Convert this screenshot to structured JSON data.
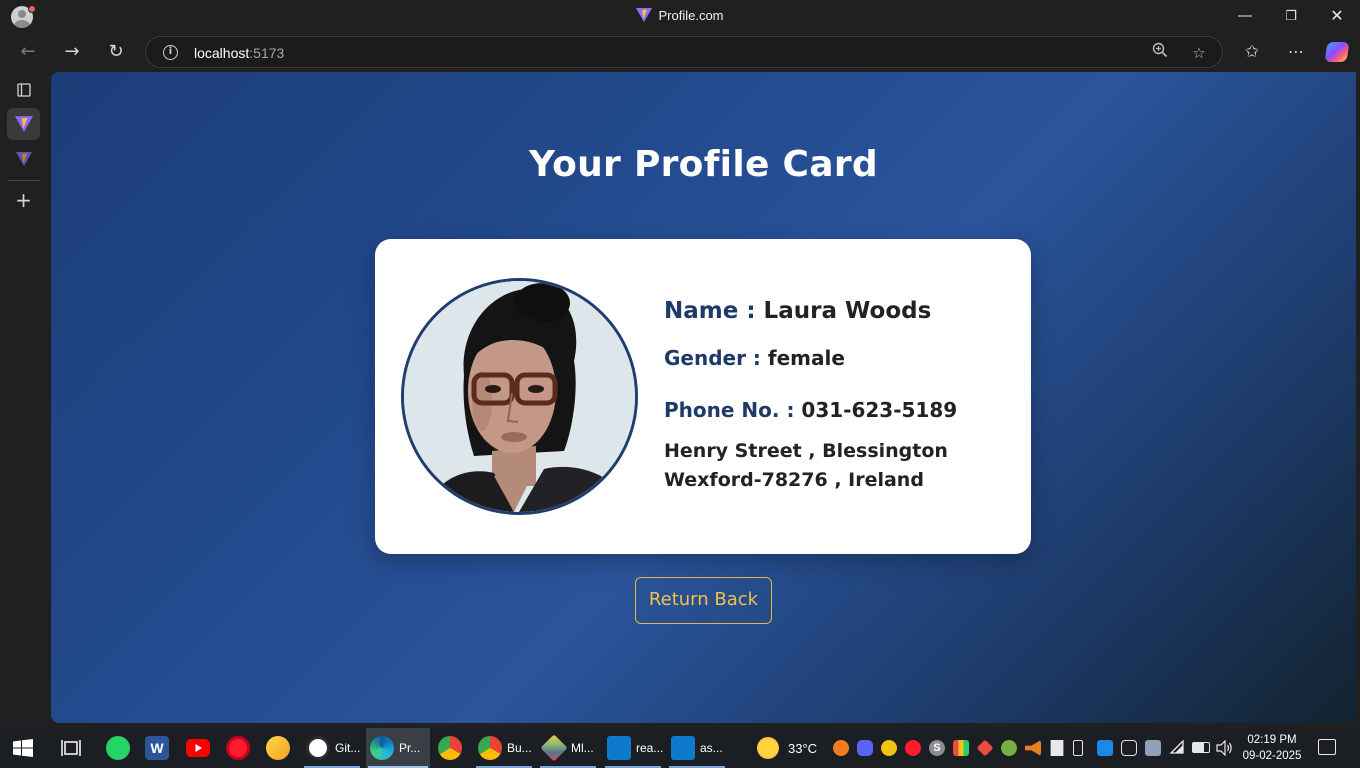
{
  "window": {
    "title": "Profile.com"
  },
  "browser": {
    "url_host": "localhost",
    "url_port": ":5173"
  },
  "page": {
    "title": "Your Profile Card",
    "profile": {
      "name_label": "Name : ",
      "name_value": " Laura  Woods",
      "gender_label": "Gender : ",
      "gender_value": "female",
      "phone_label": "Phone No. : ",
      "phone_value": "031-623-5189",
      "address_line1": "Henry Street , Blessington",
      "address_line2": "Wexford-78276 , Ireland"
    },
    "return_button": "Return Back"
  },
  "taskbar": {
    "apps": [
      {
        "label": "Git..."
      },
      {
        "label": "Pr..."
      },
      {
        "label": "Bu..."
      },
      {
        "label": "Ml..."
      },
      {
        "label": "rea..."
      },
      {
        "label": "as..."
      }
    ],
    "weather": "33°C",
    "time": "02:19 PM",
    "date": "09-02-2025"
  },
  "colors": {
    "accent_gold": "#f2c14e",
    "label_navy": "#1e3a68",
    "page_gradient_mid": "#2a549c"
  }
}
